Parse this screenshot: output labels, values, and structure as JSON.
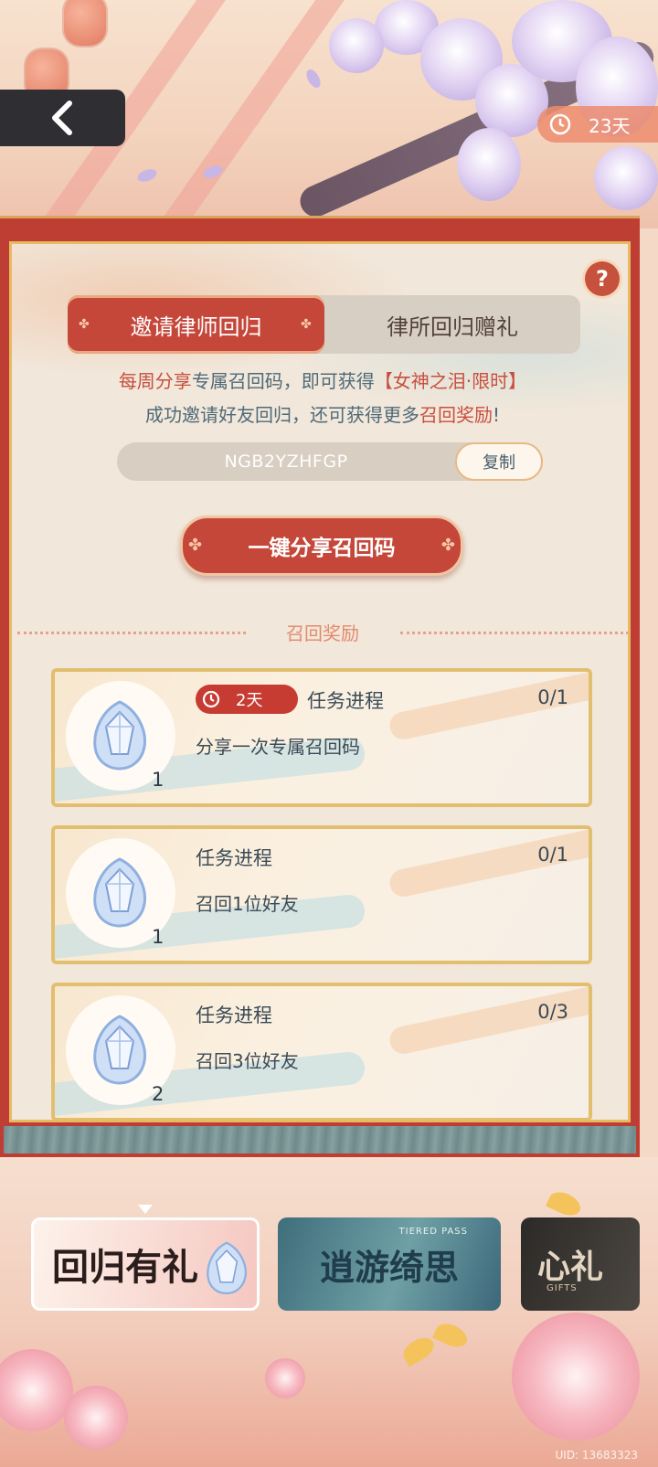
{
  "header": {
    "back_label": "",
    "timer": {
      "icon": "clock-icon",
      "text": "23天"
    }
  },
  "panel": {
    "help_label": "?",
    "tabs": [
      {
        "label": "邀请律师回归",
        "active": true
      },
      {
        "label": "律所回归赠礼",
        "active": false
      }
    ],
    "description": {
      "line1_prefix": "每周分享",
      "line1_mid": "专属召回码，即可获得",
      "line1_highlight": "【女神之泪·限时】",
      "line2_prefix": "成功邀请好友回归，还可获得更多",
      "line2_highlight": "召回奖励",
      "line2_suffix": "!"
    },
    "recall_code": "NGB2YZHFGP",
    "copy_label": "复制",
    "share_button_label": "一键分享召回码",
    "section_title": "召回奖励"
  },
  "rewards": [
    {
      "time_badge": "2天",
      "label": "任务进程",
      "progress": "0/1",
      "task": "分享一次专属召回码",
      "quantity": "1",
      "icon": "tear-gem-icon"
    },
    {
      "time_badge": "",
      "label": "任务进程",
      "progress": "0/1",
      "task": "召回1位好友",
      "quantity": "1",
      "icon": "tear-gem-icon"
    },
    {
      "time_badge": "",
      "label": "任务进程",
      "progress": "0/3",
      "task": "召回3位好友",
      "quantity": "2",
      "icon": "tear-gem-icon"
    }
  ],
  "bottom_nav": [
    {
      "label": "回归有礼",
      "sub": "",
      "selected": true
    },
    {
      "label": "逍游绮思",
      "sub": "TIERED PASS",
      "selected": false
    },
    {
      "label": "心礼",
      "sub": "GIFTS",
      "selected": false
    }
  ],
  "uid_text": "UID: 13683323",
  "colors": {
    "accent_red": "#c4473a",
    "highlight_text": "#c84f3e",
    "body_text": "#4f6a78",
    "panel_bg": "#f1e7da",
    "gold_border": "#e2bf6f"
  }
}
